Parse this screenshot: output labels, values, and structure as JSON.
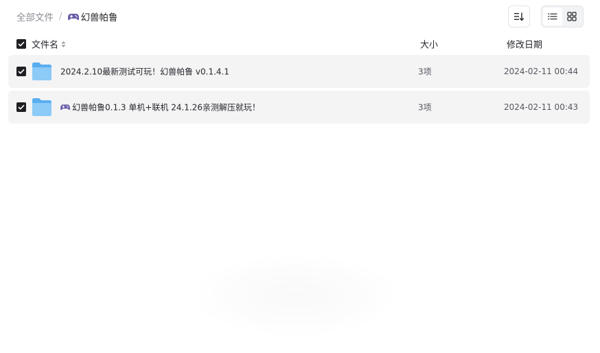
{
  "breadcrumb": {
    "root": "全部文件",
    "separator": "/",
    "current": "幻兽帕鲁",
    "current_icon": "gamepad-icon"
  },
  "toolbar": {
    "sort_icon": "sort-list-icon",
    "view_options": [
      "list-view-icon",
      "grid-view-icon"
    ],
    "active_view": "list"
  },
  "table": {
    "columns": {
      "name": "文件名",
      "size": "大小",
      "modified": "修改日期"
    },
    "rows": [
      {
        "name": "2024.2.10最新测试可玩！幻兽帕鲁 v0.1.4.1",
        "size": "3项",
        "modified": "2024-02-11 00:44",
        "checked": true,
        "has_icon": false
      },
      {
        "name": "幻兽帕鲁0.1.3 单机+联机 24.1.26亲测解压就玩！",
        "size": "3项",
        "modified": "2024-02-11 00:43",
        "checked": true,
        "has_icon": true,
        "name_icon": "gamepad-icon"
      }
    ]
  },
  "colors": {
    "row_bg": "#f4f4f5",
    "checkbox": "#1f1f23",
    "folder": "#7fc2f5",
    "gamepad": "#6a5ea8"
  }
}
